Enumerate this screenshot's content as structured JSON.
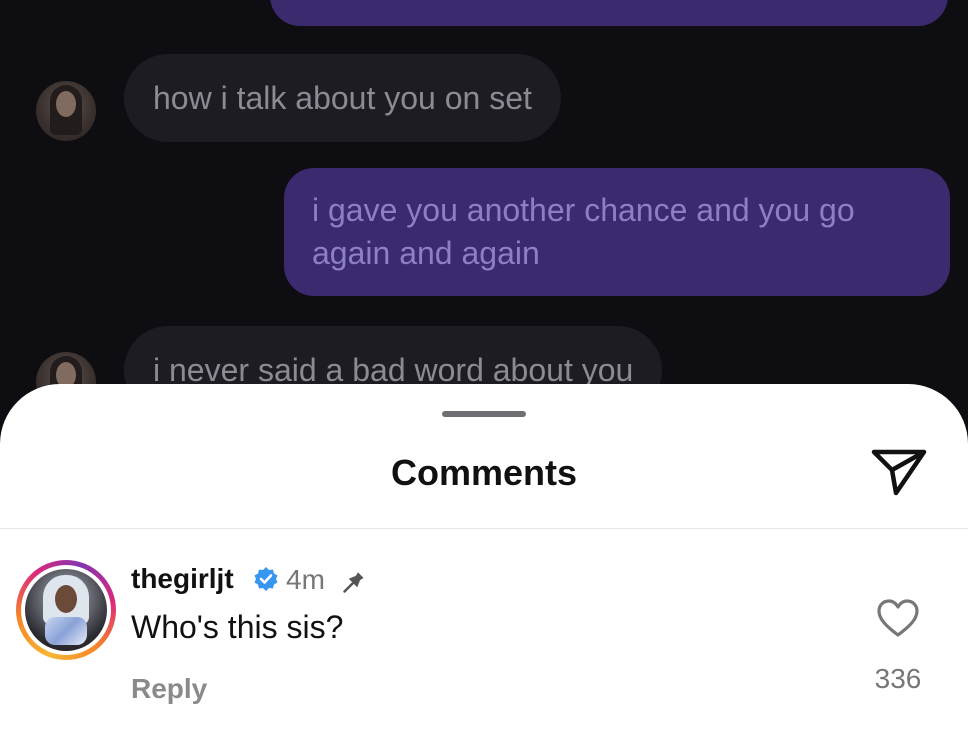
{
  "messages": [
    {
      "direction": "outgoing",
      "text": ""
    },
    {
      "direction": "incoming",
      "text": "how i talk about you on set"
    },
    {
      "direction": "outgoing",
      "text": "i gave you another chance and you go again and again"
    },
    {
      "direction": "incoming",
      "text": "i never said a bad word about you"
    }
  ],
  "sheet": {
    "title": "Comments",
    "send_icon": "paper-plane-icon"
  },
  "comment": {
    "username": "thegirljt",
    "verified_icon": "verified-badge-icon",
    "time": "4m",
    "pin_icon": "pin-icon",
    "text": "Who's this sis?",
    "reply_label": "Reply",
    "like_icon": "heart-outline-icon",
    "like_count": "336"
  },
  "colors": {
    "chat_background": "#0e0d12",
    "incoming_bubble": "#1d1c22",
    "outgoing_bubble": "#3b2a6e",
    "verified_blue": "#3797f0"
  }
}
